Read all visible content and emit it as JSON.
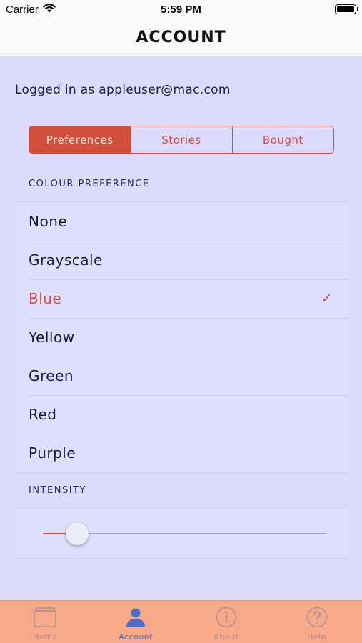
{
  "status_bar": {
    "carrier": "Carrier",
    "time": "5:59 PM"
  },
  "nav": {
    "title": "ACCOUNT"
  },
  "account": {
    "logged_in_text": "Logged in as appleuser@mac.com"
  },
  "segments": [
    {
      "label": "Preferences",
      "selected": true
    },
    {
      "label": "Stories",
      "selected": false
    },
    {
      "label": "Bought",
      "selected": false
    }
  ],
  "colour_section": {
    "header": "COLOUR PREFERENCE"
  },
  "colour_options": [
    {
      "label": "None"
    },
    {
      "label": "Grayscale"
    },
    {
      "label": "Blue",
      "selected": true
    },
    {
      "label": "Yellow"
    },
    {
      "label": "Green"
    },
    {
      "label": "Red"
    },
    {
      "label": "Purple"
    }
  ],
  "intensity_section": {
    "header": "INTENSITY",
    "value": 0.12
  },
  "tab_bar": [
    {
      "label": "Home",
      "icon": "home-icon"
    },
    {
      "label": "Account",
      "icon": "person-icon",
      "active": true
    },
    {
      "label": "About",
      "icon": "info-icon"
    },
    {
      "label": "Help",
      "icon": "question-icon"
    }
  ],
  "colors": {
    "accent": "#d0503c",
    "background": "#dcdbfd",
    "tab_bar": "#f7a98a",
    "tab_active": "#4a6ec9"
  }
}
